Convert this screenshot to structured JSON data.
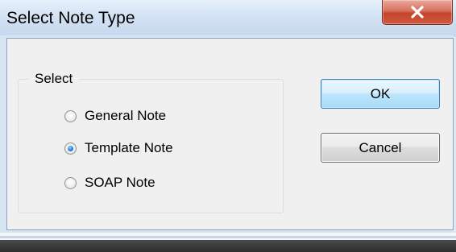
{
  "window": {
    "title": "Select Note Type",
    "close_icon": "close-icon"
  },
  "group": {
    "legend": "Select",
    "options": [
      {
        "label": "General Note",
        "checked": false
      },
      {
        "label": "Template Note",
        "checked": true
      },
      {
        "label": "SOAP Note",
        "checked": false
      }
    ]
  },
  "buttons": {
    "ok_label": "OK",
    "cancel_label": "Cancel"
  },
  "colors": {
    "close_button": "#c4432d",
    "default_button_border": "#3c7fb1",
    "radio_selected": "#2a86d6"
  }
}
